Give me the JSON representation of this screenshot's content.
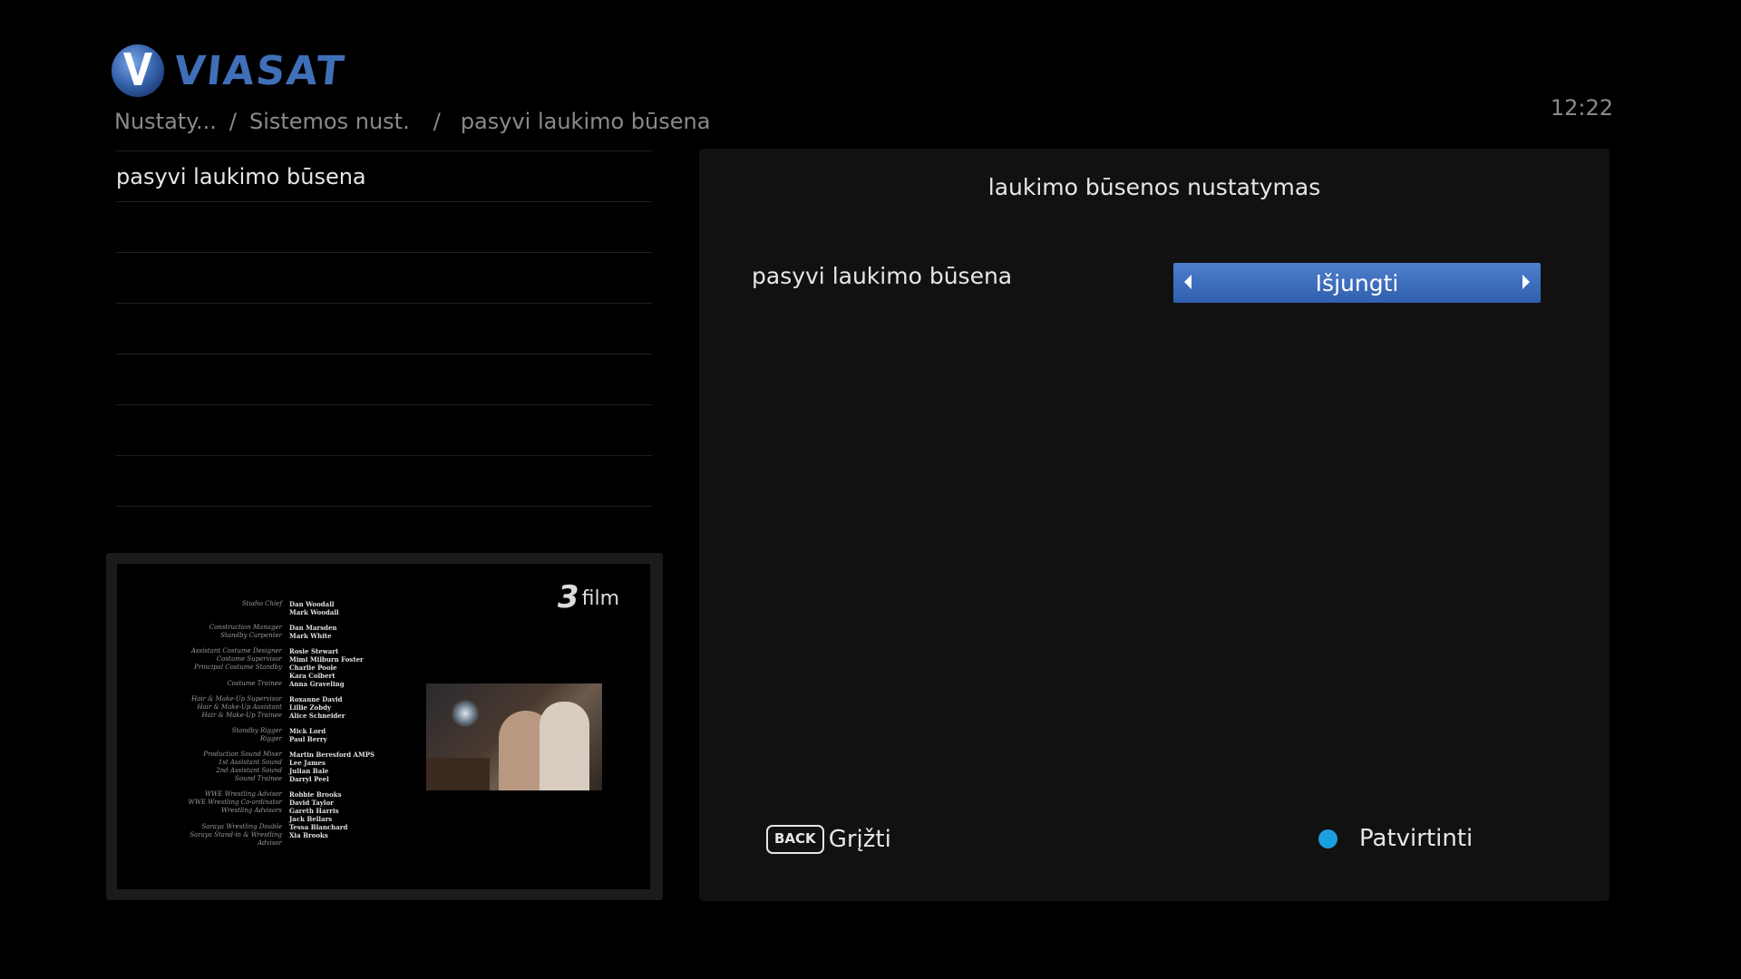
{
  "brand": {
    "name": "VIASAT",
    "mark_icon": "viasat-v-logo-icon",
    "color": "#3f6fb8"
  },
  "breadcrumb": {
    "items": [
      "Nustaty...",
      "Sistemos nust.",
      "pasyvi laukimo būsena"
    ],
    "separator": "/"
  },
  "clock": "12:22",
  "menu": {
    "items": [
      "pasyvi laukimo būsena",
      "",
      "",
      "",
      "",
      "",
      ""
    ]
  },
  "preview": {
    "channel_logo_number": "3",
    "channel_logo_name": "film",
    "credits": [
      [
        {
          "role": "Studio Chief",
          "name": "Dan Woodall"
        },
        {
          "role": "",
          "name": "Mark Woodall"
        }
      ],
      [
        {
          "role": "Construction Manager",
          "name": "Dan Marsden"
        },
        {
          "role": "Standby Carpenter",
          "name": "Mark White"
        }
      ],
      [
        {
          "role": "Assistant Costume Designer",
          "name": "Rosie Stewart"
        },
        {
          "role": "Costume Supervisor",
          "name": "Mimi Milburn Foster"
        },
        {
          "role": "Principal Costume Standby",
          "name": "Charlie Poole"
        },
        {
          "role": "",
          "name": "Kara Colbert"
        },
        {
          "role": "Costume Trainee",
          "name": "Anna Graveling"
        }
      ],
      [
        {
          "role": "Hair & Make-Up Supervisor",
          "name": "Roxanne David"
        },
        {
          "role": "Hair & Make-Up Assistant",
          "name": "Lillie Zobdy"
        },
        {
          "role": "Hair & Make-Up Trainee",
          "name": "Alice Schneider"
        }
      ],
      [
        {
          "role": "Standby Rigger",
          "name": "Mick Lord"
        },
        {
          "role": "Rigger",
          "name": "Paul Berry"
        }
      ],
      [
        {
          "role": "Production Sound Mixer",
          "name": "Martin Beresford AMPS"
        },
        {
          "role": "1st Assistant Sound",
          "name": "Lee James"
        },
        {
          "role": "2nd Assistant Sound",
          "name": "Julian Bale"
        },
        {
          "role": "Sound Trainee",
          "name": "Darryl Peel"
        }
      ],
      [
        {
          "role": "WWE Wrestling Advisor",
          "name": "Robbie Brooks"
        },
        {
          "role": "WWE Wrestling Co-ordinator",
          "name": "David Taylor"
        },
        {
          "role": "Wrestling Advisors",
          "name": "Gareth Harris"
        },
        {
          "role": "",
          "name": "Jack Bellars"
        },
        {
          "role": "Saraya Wrestling Double",
          "name": "Tessa Blanchard"
        },
        {
          "role": "Saraya Stand-in & Wrestling Advisor",
          "name": "Xia Brooks"
        }
      ]
    ]
  },
  "panel": {
    "title": "laukimo būsenos nustatymas",
    "setting_label": "pasyvi laukimo būsena",
    "setting_value": "Išjungti",
    "selector_color": "#3f6fbf"
  },
  "footer": {
    "back_key": "BACK",
    "back_label": "Grįžti",
    "confirm_label": "Patvirtinti",
    "confirm_color": "#1aa0e0"
  }
}
